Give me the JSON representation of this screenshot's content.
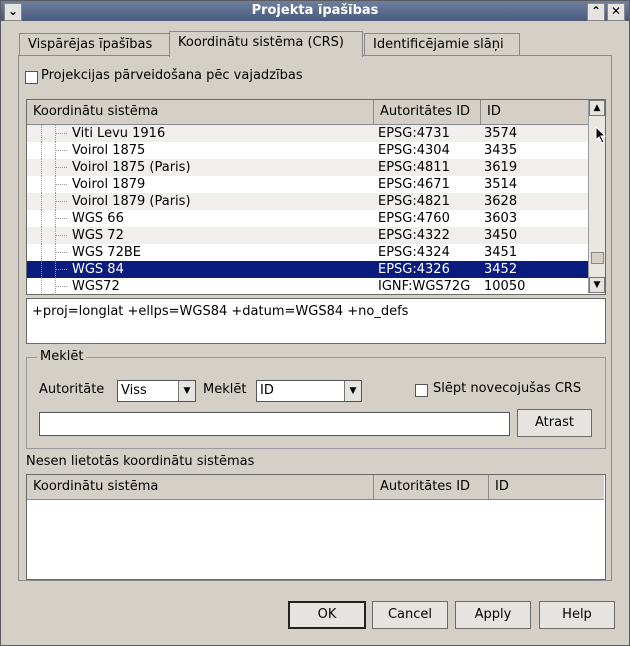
{
  "window": {
    "title": "Projekta īpašības"
  },
  "tabs": [
    {
      "label": "Vispārējas īpašības"
    },
    {
      "label": "Koordinātu sistēma (CRS)"
    },
    {
      "label": "Identificējamie slāņi"
    }
  ],
  "crs": {
    "transform_checkbox_label": "Projekcijas pārveidošana pēc vajadzības",
    "columns": [
      "Koordinātu sistēma",
      "Autoritātes ID",
      "ID"
    ],
    "rows": [
      {
        "name": "Viti Levu 1916",
        "auth": "EPSG:4731",
        "id": "3574"
      },
      {
        "name": "Voirol 1875",
        "auth": "EPSG:4304",
        "id": "3435"
      },
      {
        "name": "Voirol 1875 (Paris)",
        "auth": "EPSG:4811",
        "id": "3619"
      },
      {
        "name": "Voirol 1879",
        "auth": "EPSG:4671",
        "id": "3514"
      },
      {
        "name": "Voirol 1879 (Paris)",
        "auth": "EPSG:4821",
        "id": "3628"
      },
      {
        "name": "WGS 66",
        "auth": "EPSG:4760",
        "id": "3603"
      },
      {
        "name": "WGS 72",
        "auth": "EPSG:4322",
        "id": "3450"
      },
      {
        "name": "WGS 72BE",
        "auth": "EPSG:4324",
        "id": "3451"
      },
      {
        "name": "WGS 84",
        "auth": "EPSG:4326",
        "id": "3452"
      },
      {
        "name": "WGS72",
        "auth": "IGNF:WGS72G",
        "id": "10050"
      }
    ],
    "selected_row": 8,
    "proj_string": "+proj=longlat +ellps=WGS84 +datum=WGS84 +no_defs"
  },
  "search": {
    "group_title": "Meklēt",
    "authority_label": "Autoritāte",
    "authority_value": "Viss",
    "search_label": "Meklēt",
    "search_value": "ID",
    "hide_deprecated_label": "Slēpt novecojušas CRS",
    "input_value": "",
    "find_button": "Atrast"
  },
  "recent": {
    "title": "Nesen lietotās koordinātu sistēmas",
    "columns": [
      "Koordinātu sistēma",
      "Autoritātes ID",
      "ID"
    ]
  },
  "buttons": {
    "ok": "OK",
    "cancel": "Cancel",
    "apply": "Apply",
    "help": "Help"
  }
}
